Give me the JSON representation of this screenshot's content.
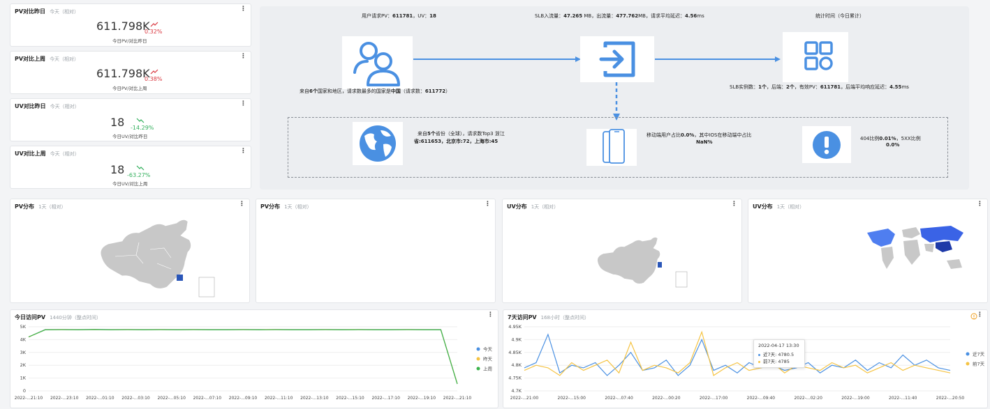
{
  "kpis": [
    {
      "title": "PV对比昨日",
      "sub": "今天（相对）",
      "value": "611.798K",
      "pct": "0.32%",
      "cap": "今日PV/对比昨日",
      "trend": "up"
    },
    {
      "title": "PV对比上周",
      "sub": "今天（相对）",
      "value": "611.798K",
      "pct": "0.38%",
      "cap": "今日PV/对比上周",
      "trend": "up"
    },
    {
      "title": "UV对比昨日",
      "sub": "今天（相对）",
      "value": "18",
      "pct": "-14.29%",
      "cap": "今日UV/对比昨日",
      "trend": "down"
    },
    {
      "title": "UV对比上周",
      "sub": "今天（相对）",
      "value": "18",
      "pct": "-63.27%",
      "cap": "今日UV/对比上周",
      "trend": "down"
    }
  ],
  "menu_glyph": "⋮",
  "flow": {
    "top_left_prefix": "用户请求PV：",
    "pv": "611781",
    "uv_prefix": "，UV：",
    "uv": "18",
    "slb_in_prefix": "SLB入流量：",
    "slb_in": "47.265",
    "slb_out_prefix": " MB，出流量：",
    "slb_out": "477.762",
    "slb_lat_prefix": "MB，请求平均延迟：",
    "slb_lat": "4.56",
    "slb_lat_unit": "ms",
    "stat_time": "统计时间（今日累计）",
    "countries_prefix": "来自",
    "countries_n": "6个",
    "countries_mid": "国家和地区，请求数最多的国家是",
    "country": "中国",
    "countries_suffix": "（请求数：",
    "country_req": "611772",
    "countries_end": "）",
    "slb_inst_prefix": "SLB实例数：",
    "slb_inst": "1个",
    "backend_prefix": "，后端：",
    "backend": "2个",
    "valid_prefix": "，有效PV：",
    "valid_pv": "611781",
    "backend_lat_prefix": "，后端平均响应延迟：",
    "backend_lat": "4.55",
    "backend_lat_unit": "ms",
    "prov_l1_prefix": "来自",
    "prov_n": "5个",
    "prov_l1_mid": "省份（全球），请求数Top3 浙江",
    "prov_l2": "省:611653，北京市:72，上海市:45",
    "mobile_l1": "移动端用户占比",
    "mobile_pct": "0.0%",
    "mobile_l1b": "，其中IOS在移动端中占比",
    "mobile_l2": "NaN%",
    "err_l1a": "404比例",
    "err_404": "0.01%",
    "err_l1b": "，5XX比例",
    "err_l2": "0.0%"
  },
  "maps": [
    {
      "title": "PV分布",
      "sub": "1天（相对）"
    },
    {
      "title": "PV分布",
      "sub": "1天（相对）"
    },
    {
      "title": "UV分布",
      "sub": "1天（相对）"
    },
    {
      "title": "UV分布",
      "sub": "1天（相对）"
    }
  ],
  "chart_data": [
    {
      "type": "line",
      "title": "今日访问PV",
      "subtitle": "1440分钟（整点时间）",
      "y_ticks": [
        "5K",
        "4K",
        "3K",
        "2K",
        "1K",
        "0"
      ],
      "ylim": [
        0,
        5000
      ],
      "x_ticks": [
        "2022-...21:10",
        "2022-...23:10",
        "2022-...01:10",
        "2022-...03:10",
        "2022-...05:10",
        "2022-...07:10",
        "2022-...09:10",
        "2022-...11:10",
        "2022-...13:10",
        "2022-...15:10",
        "2022-...17:10",
        "2022-...19:10",
        "2022-...21:10"
      ],
      "series": [
        {
          "name": "今天",
          "color": "#4a90e2",
          "values": [
            4200,
            4780,
            4790,
            4780,
            4800,
            4780,
            4790,
            4780,
            4790,
            4780,
            4790,
            4780,
            4780,
            4790,
            4780,
            4790,
            4780,
            4780,
            4790,
            4780,
            4790,
            4780,
            4780,
            4790,
            4780,
            4780,
            550
          ]
        },
        {
          "name": "昨天",
          "color": "#f5c342",
          "values": [
            4200,
            4770,
            4780,
            4770,
            4790,
            4770,
            4780,
            4770,
            4780,
            4770,
            4780,
            4770,
            4770,
            4780,
            4770,
            4780,
            4770,
            4770,
            4780,
            4770,
            4780,
            4770,
            4770,
            4780,
            4770,
            4770,
            560
          ]
        },
        {
          "name": "上周",
          "color": "#3cb44b",
          "values": [
            4210,
            4760,
            4770,
            4760,
            4780,
            4760,
            4770,
            4760,
            4770,
            4760,
            4770,
            4760,
            4760,
            4770,
            4760,
            4770,
            4760,
            4760,
            4770,
            4760,
            4770,
            4760,
            4760,
            4770,
            4760,
            4760,
            540
          ]
        }
      ],
      "legend": "right"
    },
    {
      "type": "line",
      "title": "7天访问PV",
      "subtitle": "168小时（整点时间）",
      "y_ticks": [
        "4.95K",
        "4.9K",
        "4.85K",
        "4.8K",
        "4.75K",
        "4.7K"
      ],
      "ylim": [
        4700,
        4950
      ],
      "x_ticks": [
        "2022-...21:00",
        "2022-...15:00",
        "2022-...07:40",
        "2022-...00:20",
        "2022-...17:00",
        "2022-...09:40",
        "2022-...02:20",
        "2022-...19:00",
        "2022-...11:40",
        "2022-...20:50"
      ],
      "series": [
        {
          "name": "近7天",
          "color": "#4a90e2",
          "values": [
            4790,
            4810,
            4920,
            4770,
            4800,
            4790,
            4810,
            4760,
            4800,
            4850,
            4780,
            4790,
            4820,
            4760,
            4800,
            4900,
            4780,
            4800,
            4770,
            4810,
            4790,
            4800,
            4780,
            4790,
            4810,
            4770,
            4800,
            4790,
            4820,
            4780,
            4810,
            4790,
            4840,
            4800,
            4820,
            4790,
            4780
          ]
        },
        {
          "name": "前7天",
          "color": "#f5c342",
          "values": [
            4780,
            4800,
            4790,
            4760,
            4810,
            4780,
            4800,
            4820,
            4770,
            4890,
            4780,
            4800,
            4790,
            4770,
            4810,
            4930,
            4760,
            4790,
            4810,
            4780,
            4790,
            4810,
            4770,
            4800,
            4790,
            4780,
            4810,
            4790,
            4800,
            4770,
            4790,
            4810,
            4780,
            4800,
            4790,
            4780,
            4770
          ]
        }
      ],
      "legend": "right",
      "tooltip": {
        "time": "2022-04-17 13:30",
        "row1": "近7天: 4780.5",
        "row2": "前7天: 4785"
      }
    }
  ],
  "colors": {
    "arrow": "#4a90e2",
    "icon": "#4a90e2"
  },
  "icons": {
    "users": "users-icon",
    "login": "login-arrow-icon",
    "apps": "apps-grid-icon",
    "globe": "globe-icon",
    "phone": "mobile-phone-icon",
    "alert": "alert-icon",
    "info": "info-icon",
    "trend_up": "trend-up-icon",
    "trend_down": "trend-down-icon"
  }
}
